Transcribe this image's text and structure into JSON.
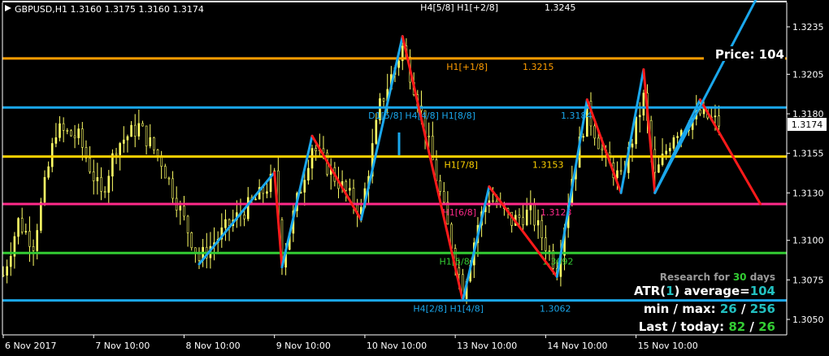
{
  "chart_data": {
    "type": "candlestick",
    "title": "GBPUSD,H1  1.3160 1.3175 1.3160 1.3174",
    "symbol": "GBPUSD",
    "timeframe": "H1",
    "ohlc_last": {
      "open": 1.316,
      "high": 1.3175,
      "low": 1.316,
      "close": 1.3174
    },
    "y_range": [
      1.304,
      1.3253
    ],
    "y_ticks": [
      1.3235,
      1.3205,
      1.318,
      1.3155,
      1.313,
      1.31,
      1.3075,
      1.305
    ],
    "current_price_label": "1.3174",
    "current_price": 1.3174,
    "x_labels": [
      "6 Nov 2017",
      "7 Nov 10:00",
      "8 Nov 10:00",
      "9 Nov 10:00",
      "10 Nov 10:00",
      "13 Nov 10:00",
      "14 Nov 10:00",
      "15 Nov 10:00"
    ],
    "murrey_levels": [
      {
        "label": "H4[5/8] H1[+2/8]",
        "value_label": "1.3245",
        "value": 1.3251,
        "color": "#ffffff"
      },
      {
        "label": "H1[+1/8]",
        "value_label": "1.3215",
        "value": 1.3215,
        "color": "#ff9c00"
      },
      {
        "label": "D1[5/8] H4[4/8] H1[8/8]",
        "value_label": "1.3184",
        "value": 1.3184,
        "color": "#1aa7ec"
      },
      {
        "label": "H1[7/8]",
        "value_label": "1.3153",
        "value": 1.3153,
        "color": "#ffd200"
      },
      {
        "label": "H1[6/8]",
        "value_label": "1.3123",
        "value": 1.3123,
        "color": "#ff2a8a"
      },
      {
        "label": "H1[5/8]",
        "value_label": "1.3092",
        "value": 1.3092,
        "color": "#33cc33"
      },
      {
        "label": "H4[2/8] H1[4/8]",
        "value_label": "1.3062",
        "value": 1.3062,
        "color": "#1aa7ec"
      }
    ],
    "zigzag_points": [
      {
        "t": 52,
        "p": 1.3085
      },
      {
        "t": 72,
        "p": 1.3143
      },
      {
        "t": 74,
        "p": 1.3083
      },
      {
        "t": 82,
        "p": 1.3166
      },
      {
        "t": 95,
        "p": 1.3113
      },
      {
        "t": 106,
        "p": 1.3229
      },
      {
        "t": 122,
        "p": 1.3062
      },
      {
        "t": 129,
        "p": 1.3134
      },
      {
        "t": 147,
        "p": 1.3077
      },
      {
        "t": 155,
        "p": 1.3189
      },
      {
        "t": 164,
        "p": 1.313
      },
      {
        "t": 170,
        "p": 1.3208
      },
      {
        "t": 173,
        "p": 1.313
      },
      {
        "t": 185,
        "p": 1.3189
      },
      {
        "t": 201,
        "p": 1.3123
      }
    ],
    "zigzag_extension": [
      {
        "t": 173,
        "p": 1.313
      },
      {
        "t": 200,
        "p": 1.3253
      }
    ],
    "grid": false
  },
  "panel": {
    "price_label": "Price: 104",
    "research_prefix": "Research for ",
    "research_days": "30",
    "research_suffix": " days",
    "atr_prefix": "ATR(",
    "atr_period": "1",
    "atr_middle": ") average=",
    "atr_value": "104",
    "minmax_prefix": "min / max: ",
    "min_value": "26",
    "minmax_sep": " / ",
    "max_value": "256",
    "last_prefix": "Last / today: ",
    "last_value": "82",
    "last_sep": " / ",
    "today_value": "26"
  },
  "colors": {
    "background": "#000000",
    "bull_candle": "#ffff66",
    "zig_up": "#1aa7ec",
    "zig_down": "#ff1a1a",
    "panel_cyan": "#22c0c0",
    "panel_green": "#33cc33",
    "research_gray": "#9a9a9a"
  }
}
